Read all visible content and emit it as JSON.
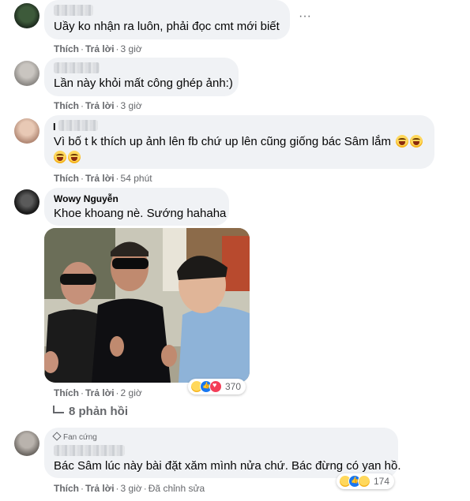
{
  "comments": [
    {
      "text": "Uầy ko nhận ra luôn, phải đọc cmt mới biết",
      "like": "Thích",
      "reply": "Trả lời",
      "time": "3 giờ"
    },
    {
      "text": "Lần này khỏi mất công ghép ảnh:)",
      "like": "Thích",
      "reply": "Trả lời",
      "time": "3 giờ"
    },
    {
      "author_initial": "I",
      "text": "Vì bố t k thích up ảnh lên fb chứ up lên cũng giống bác Sâm lắm",
      "like": "Thích",
      "reply": "Trả lời",
      "time": "54 phút"
    },
    {
      "author": "Wowy Nguyễn",
      "text": "Khoe khoang nè. Sướng hahaha",
      "like": "Thích",
      "reply": "Trả lời",
      "time": "2 giờ",
      "reaction_count": "370",
      "replies_label": "8 phản hồi"
    },
    {
      "badge": "Fan cứng",
      "text": "Bác Sâm lúc này bài đặt xăm mình nửa chứ. Bác đừng có yan hồ.",
      "like": "Thích",
      "reply": "Trả lời",
      "time": "3 giờ",
      "edited": "Đã chỉnh sửa",
      "reaction_count": "174"
    }
  ],
  "icons": {
    "more": "more-horizontal-icon",
    "reply_arrow": "reply-arrow-icon",
    "fan_badge": "diamond-icon"
  },
  "colors": {
    "bubble": "#f0f2f5",
    "meta": "#65676b",
    "like_blue": "#1877f2",
    "love_red": "#f33e58"
  }
}
